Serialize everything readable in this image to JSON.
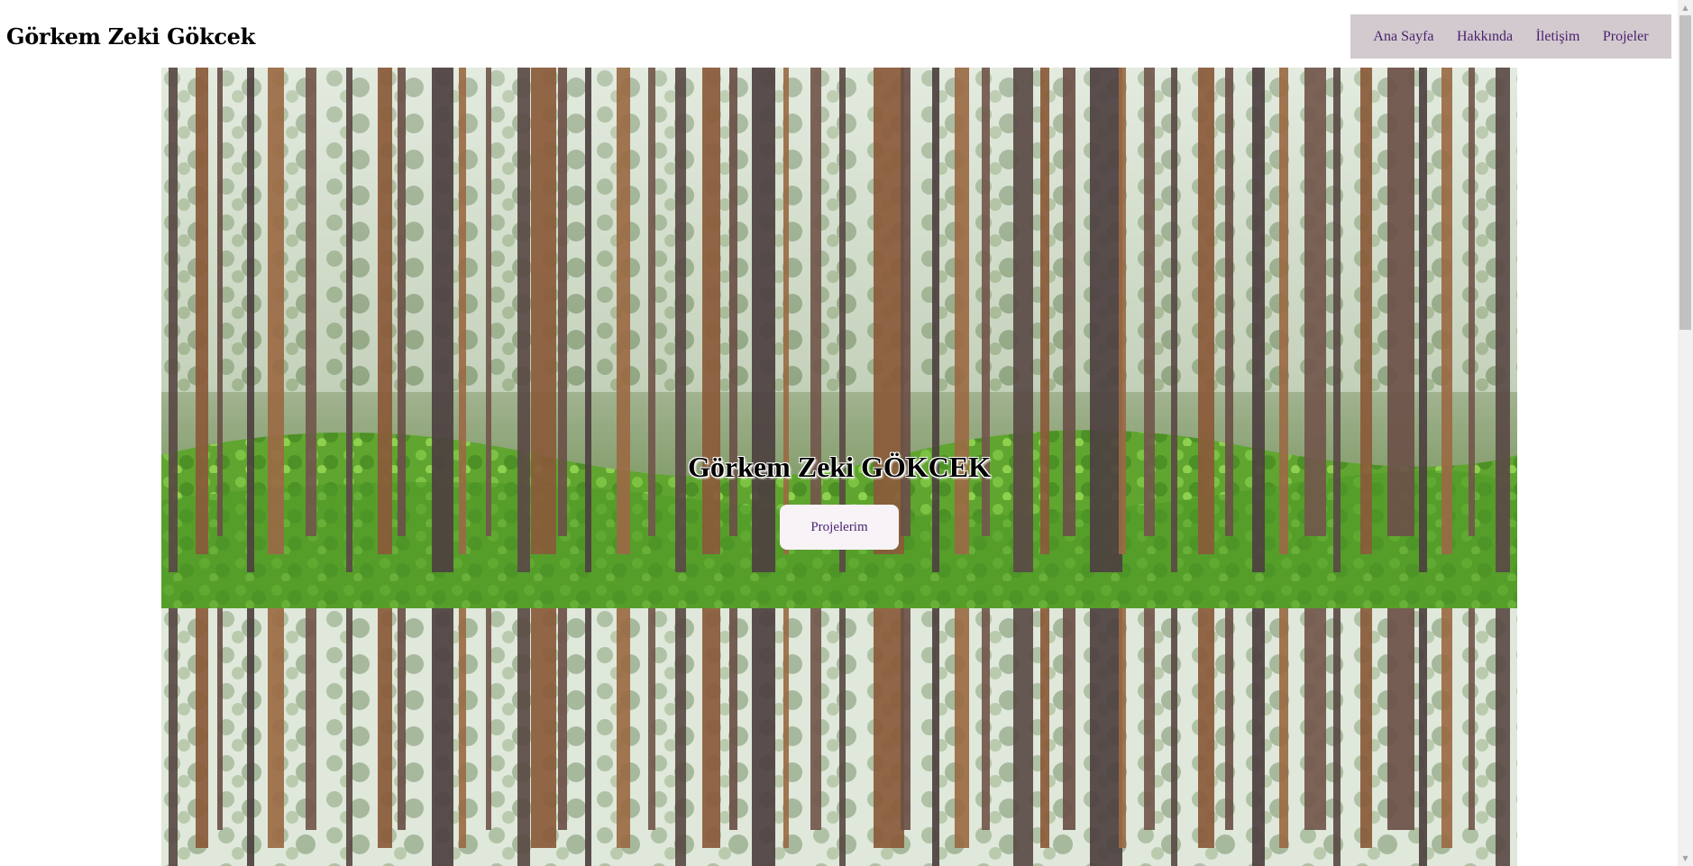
{
  "header": {
    "site_title": "Görkem Zeki Gökcek"
  },
  "nav": {
    "items": [
      {
        "label": "Ana Sayfa"
      },
      {
        "label": "Hakkında"
      },
      {
        "label": "İletişim"
      },
      {
        "label": "Projeler"
      }
    ]
  },
  "hero": {
    "heading": "Görkem Zeki GÖKCEK",
    "button_label": "Projelerim",
    "background_image": "pine-forest-photo"
  },
  "colors": {
    "nav_background": "#d2cace",
    "nav_link": "#4a1f6e",
    "button_background": "#f7f3f7"
  }
}
